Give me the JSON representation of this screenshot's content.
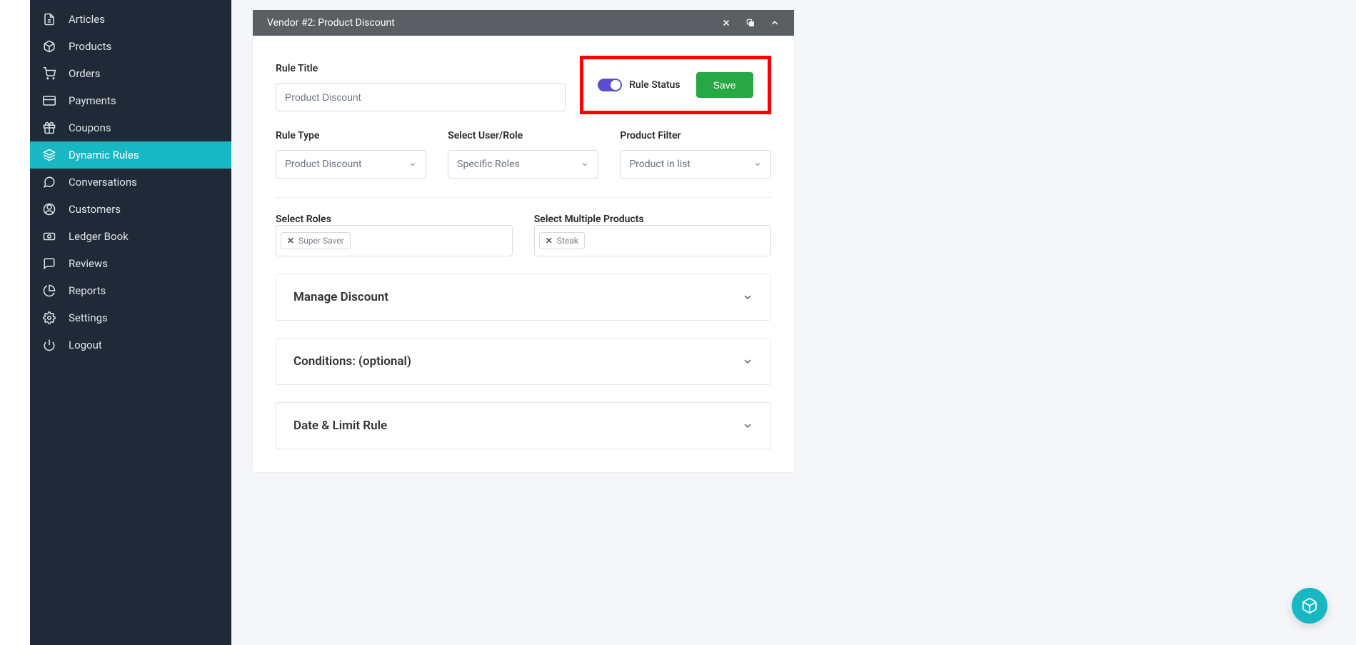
{
  "sidebar": {
    "items": [
      {
        "label": "Articles"
      },
      {
        "label": "Products"
      },
      {
        "label": "Orders"
      },
      {
        "label": "Payments"
      },
      {
        "label": "Coupons"
      },
      {
        "label": "Dynamic Rules"
      },
      {
        "label": "Conversations"
      },
      {
        "label": "Customers"
      },
      {
        "label": "Ledger Book"
      },
      {
        "label": "Reviews"
      },
      {
        "label": "Reports"
      },
      {
        "label": "Settings"
      },
      {
        "label": "Logout"
      }
    ]
  },
  "panel": {
    "header_title": "Vendor #2: Product Discount"
  },
  "form": {
    "rule_title_label": "Rule Title",
    "rule_title_value": "Product Discount",
    "rule_status_label": "Rule Status",
    "save_label": "Save",
    "rule_type_label": "Rule Type",
    "rule_type_value": "Product Discount",
    "user_role_label": "Select User/Role",
    "user_role_value": "Specific Roles",
    "product_filter_label": "Product Filter",
    "product_filter_value": "Product in list",
    "select_roles_label": "Select Roles",
    "roles_tags": [
      "Super Saver"
    ],
    "select_products_label": "Select Multiple Products",
    "products_tags": [
      "Steak"
    ]
  },
  "sections": {
    "manage_discount": "Manage Discount",
    "conditions": "Conditions: (optional)",
    "date_limit": "Date & Limit Rule"
  }
}
